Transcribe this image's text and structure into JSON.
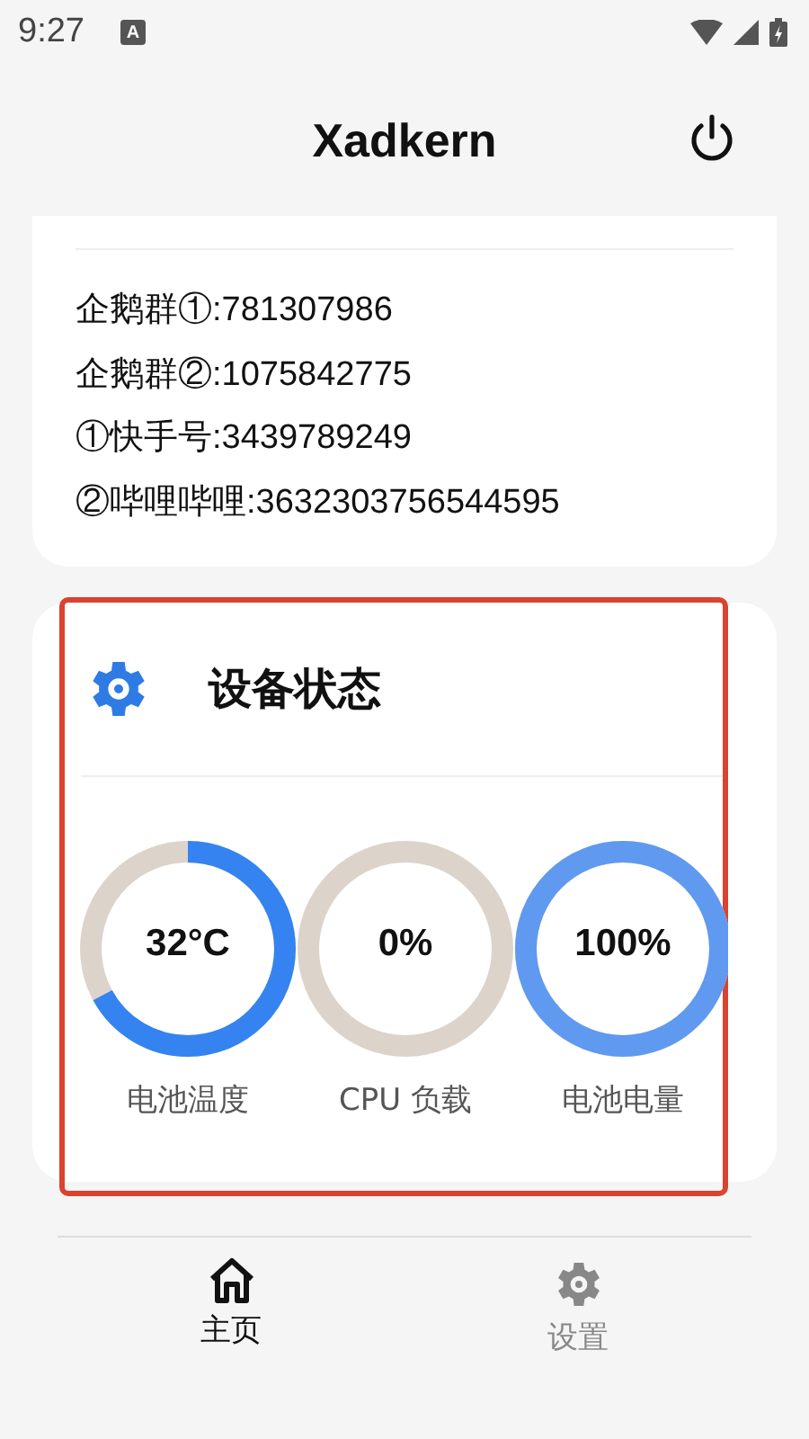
{
  "status_bar": {
    "time": "9:27",
    "notification": "A"
  },
  "header": {
    "title": "Xadkern"
  },
  "contacts": [
    "企鹅群①:781307986",
    "企鹅群②:1075842775",
    "①快手号:3439789249",
    "②哔哩哔哩:3632303756544595"
  ],
  "device_status": {
    "title": "设备状态",
    "gauges": [
      {
        "value": "32°C",
        "label": "电池温度"
      },
      {
        "value": "0%",
        "label": "CPU 负载"
      },
      {
        "value": "100%",
        "label": "电池电量"
      }
    ]
  },
  "bottom_nav": [
    {
      "label": "主页",
      "kind": "home",
      "selected": true
    },
    {
      "label": "设置",
      "kind": "settings",
      "selected": false
    }
  ]
}
